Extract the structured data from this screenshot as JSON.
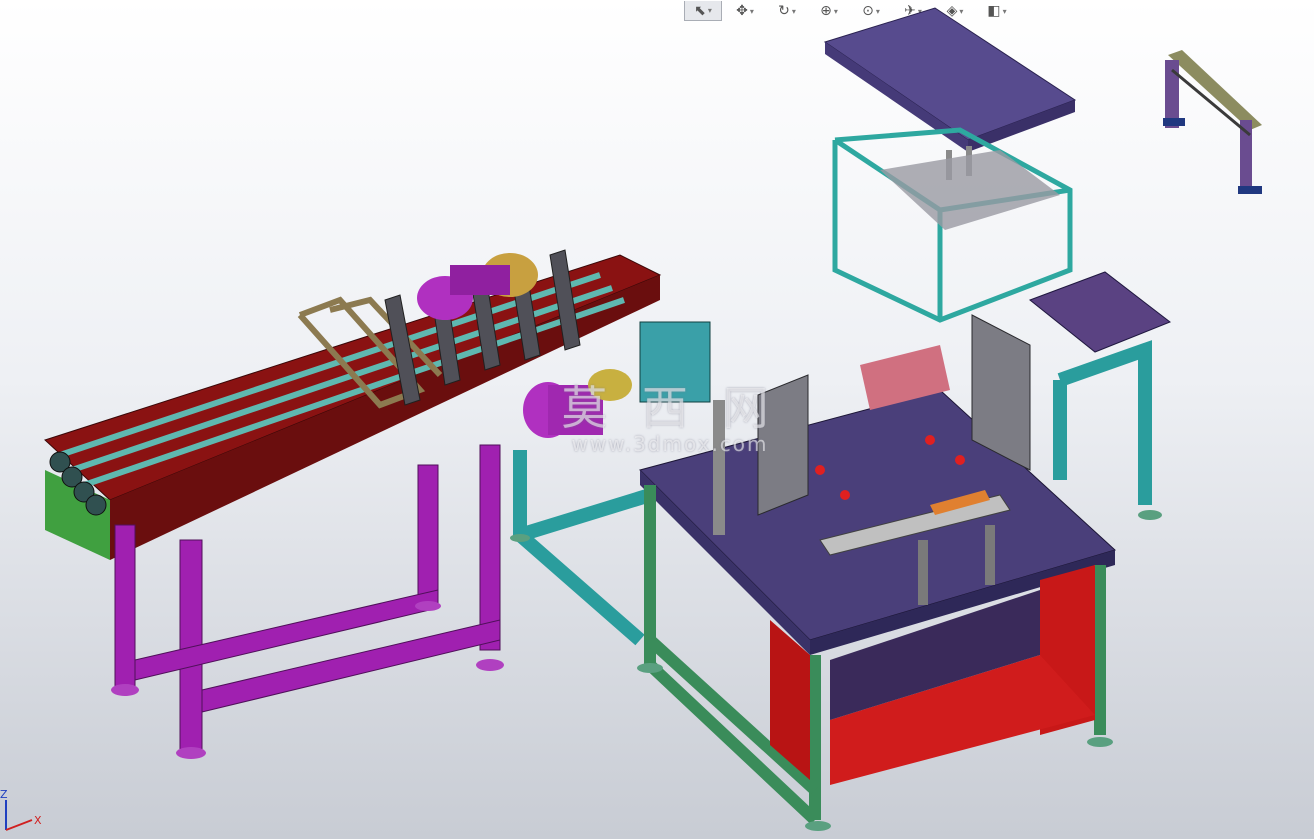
{
  "toolbar": {
    "tools": [
      {
        "name": "select-icon",
        "glyph": "⬉",
        "active": true
      },
      {
        "name": "pan-icon",
        "glyph": "✥",
        "active": false
      },
      {
        "name": "rotate-icon",
        "glyph": "↻",
        "active": false
      },
      {
        "name": "zoom-window-icon",
        "glyph": "⊕",
        "active": false
      },
      {
        "name": "zoom-fit-icon",
        "glyph": "⊙",
        "active": false
      },
      {
        "name": "view-orient-icon",
        "glyph": "✈",
        "active": false
      },
      {
        "name": "display-style-icon",
        "glyph": "◈",
        "active": false
      },
      {
        "name": "section-view-icon",
        "glyph": "◧",
        "active": false
      }
    ]
  },
  "watermark": {
    "chinese": "莫 西 网",
    "url": "www.3dmox.com"
  },
  "triad": {
    "x_label": "X",
    "z_label": "Z"
  },
  "colors": {
    "frame_magenta": "#a020b0",
    "frame_teal": "#2a9d9d",
    "frame_green": "#3a8c5a",
    "table_top": "#4a3f7a",
    "panel_red": "#c81818",
    "conveyor_dark_red": "#7a1010",
    "belt_teal": "#5fb8b0",
    "sheet_gray": "#7c7c84",
    "cover_purple": "#5a4a8c"
  }
}
